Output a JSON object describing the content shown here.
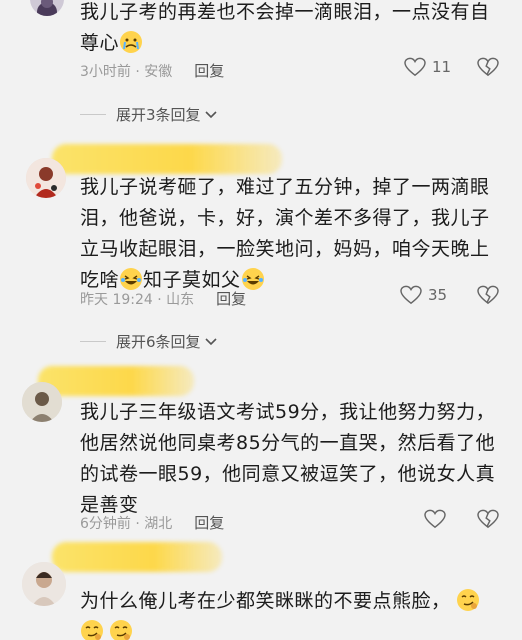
{
  "comment1": {
    "text": "我儿子考的再差也不会掉一滴眼泪，一点没有自尊心",
    "meta": "3小时前 · 安徽",
    "reply": "回复",
    "likes": "11"
  },
  "expand1": {
    "label": "展开3条回复"
  },
  "comment2": {
    "text": "我儿子说考砸了，难过了五分钟，掉了一两滴眼泪，他爸说，卡，好，演个差不多得了，我儿子立马收起眼泪，一脸笑地问，妈妈，咱今天晚上吃啥",
    "text2": "知子莫如父",
    "meta": "昨天 19:24 · 山东",
    "reply": "回复",
    "likes": "35"
  },
  "expand2": {
    "label": "展开6条回复"
  },
  "comment3": {
    "text": "我儿子三年级语文考试59分，我让他努力努力，他居然说他同桌考85分气的一直哭，然后看了他的试卷一眼59，他同意又被逗笑了，他说女人真是善变",
    "meta": "6分钟前 · 湖北",
    "reply": "回复"
  },
  "comment4": {
    "text": "为什么俺儿考在少都笑眯眯的不要点熊脸，"
  },
  "icons": {
    "like": "heart-outline-icon",
    "dislike": "broken-heart-icon",
    "expand": "chevron-down-icon"
  }
}
